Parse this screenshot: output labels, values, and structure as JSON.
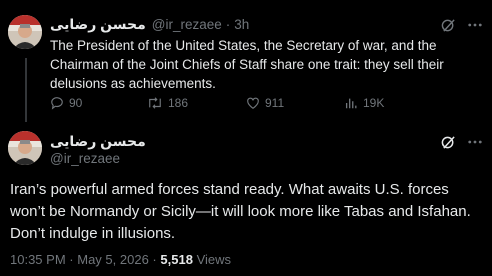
{
  "reply_tweet": {
    "author_name": "محسن رضایی",
    "handle": "@ir_rezaee",
    "separator": "·",
    "time": "3h",
    "text": "The President of the United States, the Secretary of war, and the Chairman of the Joint Chiefs of Staff share one trait: they sell their delusions as achievements.",
    "replies": "90",
    "reposts": "186",
    "likes": "911",
    "views": "19K"
  },
  "main_tweet": {
    "author_name": "محسن رضایی",
    "handle": "@ir_rezaee",
    "text": "Iran’s powerful armed forces stand ready. What awaits U.S. forces won’t be Normandy or Sicily—it will look more like Tabas and Isfahan. Don’t indulge in illusions.",
    "time": "10:35 PM",
    "dot": "·",
    "date": "May 5, 2026",
    "views_count": "5,518",
    "views_label": "Views"
  },
  "icons": [
    "avatar",
    "grok-icon",
    "more-icon",
    "reply-icon",
    "repost-icon",
    "like-icon",
    "views-icon"
  ],
  "colors": {
    "background": "#000000",
    "text": "#e7e9ea",
    "muted": "#71767b"
  }
}
